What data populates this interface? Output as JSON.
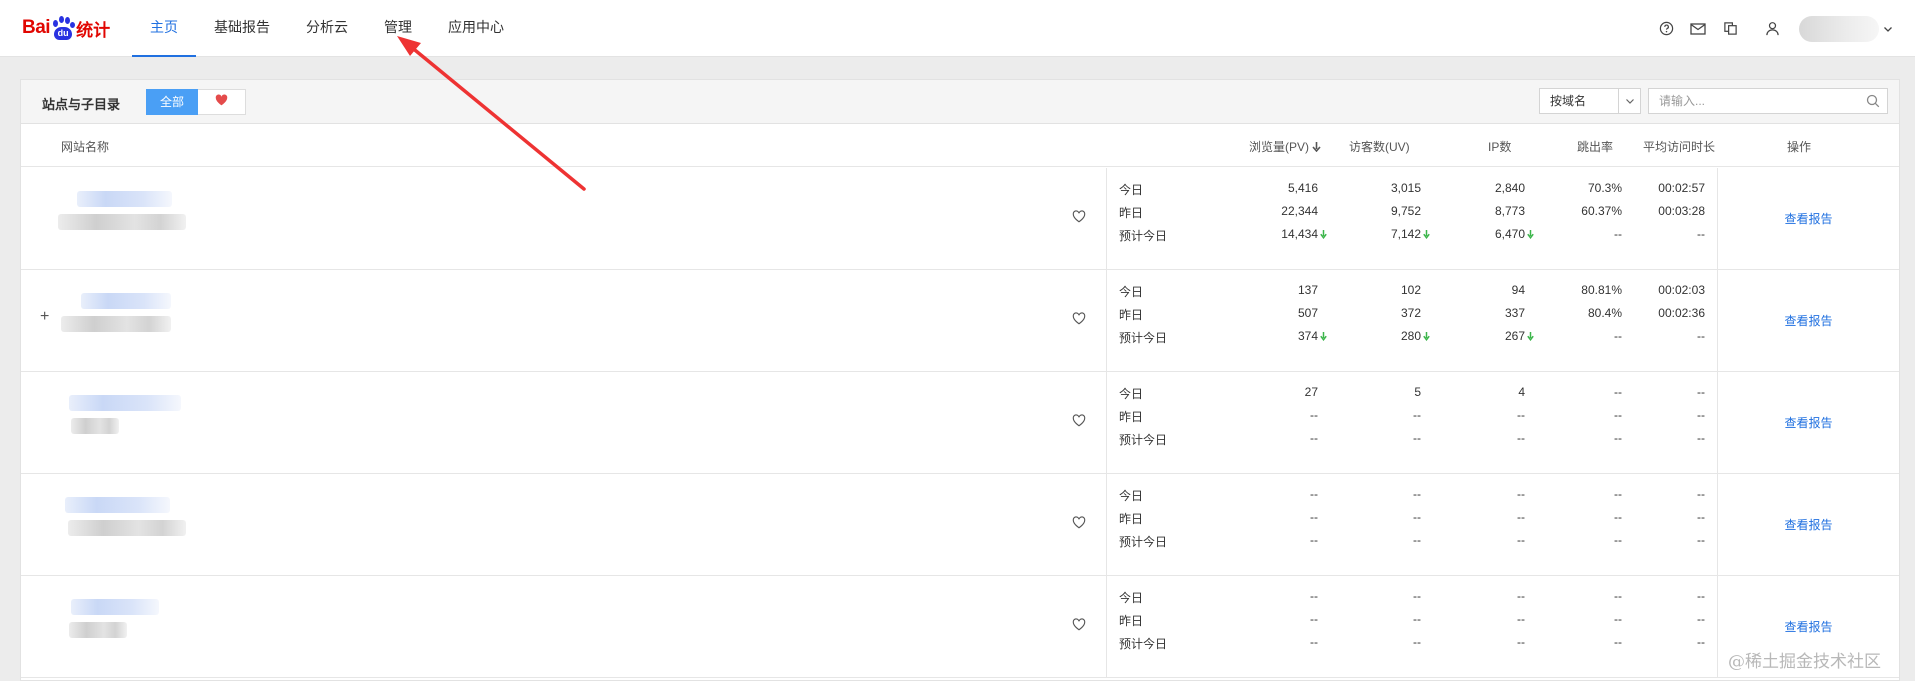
{
  "app": {
    "logo_text_bai": "Bai",
    "logo_text_du": "du",
    "logo_text_tongji": "统计"
  },
  "nav": {
    "items": [
      {
        "label": "主页",
        "active": true
      },
      {
        "label": "基础报告",
        "active": false
      },
      {
        "label": "分析云",
        "active": false
      },
      {
        "label": "管理",
        "active": false
      },
      {
        "label": "应用中心",
        "active": false
      }
    ]
  },
  "topbar_icons": [
    "help-icon",
    "mail-icon",
    "copy-icon",
    "user-icon",
    "chevron-down-icon"
  ],
  "panel": {
    "title": "站点与子目录",
    "filter_all": "全部",
    "filter_fav_icon": "heart-icon",
    "domain_select": "按域名",
    "search_placeholder": "请输入...",
    "colors": {
      "accent": "#4a9ff5",
      "link": "#2070e0",
      "heart": "#e44b4b",
      "down_arrow": "#3bb54a"
    }
  },
  "table": {
    "headers": {
      "site": "网站名称",
      "pv": "浏览量(PV)",
      "uv": "访客数(UV)",
      "ip": "IP数",
      "bounce": "跳出率",
      "avg_time": "平均访问时长",
      "action": "操作"
    },
    "sort_indicator": "pv-desc",
    "rows": [
      {
        "expandable": false,
        "action": "查看报告",
        "lines": [
          {
            "label": "今日",
            "pv": "5,416",
            "uv": "3,015",
            "ip": "2,840",
            "bounce": "70.3%",
            "avg": "00:02:57"
          },
          {
            "label": "昨日",
            "pv": "22,344",
            "uv": "9,752",
            "ip": "8,773",
            "bounce": "60.37%",
            "avg": "00:03:28"
          },
          {
            "label": "预计今日",
            "pv": "14,434",
            "uv": "7,142",
            "ip": "6,470",
            "bounce": "--",
            "avg": "--",
            "trend": "down"
          }
        ]
      },
      {
        "expandable": true,
        "expand_label": "+",
        "action": "查看报告",
        "lines": [
          {
            "label": "今日",
            "pv": "137",
            "uv": "102",
            "ip": "94",
            "bounce": "80.81%",
            "avg": "00:02:03"
          },
          {
            "label": "昨日",
            "pv": "507",
            "uv": "372",
            "ip": "337",
            "bounce": "80.4%",
            "avg": "00:02:36"
          },
          {
            "label": "预计今日",
            "pv": "374",
            "uv": "280",
            "ip": "267",
            "bounce": "--",
            "avg": "--",
            "trend": "down"
          }
        ]
      },
      {
        "expandable": false,
        "action": "查看报告",
        "lines": [
          {
            "label": "今日",
            "pv": "27",
            "uv": "5",
            "ip": "4",
            "bounce": "--",
            "avg": "--"
          },
          {
            "label": "昨日",
            "pv": "--",
            "uv": "--",
            "ip": "--",
            "bounce": "--",
            "avg": "--"
          },
          {
            "label": "预计今日",
            "pv": "--",
            "uv": "--",
            "ip": "--",
            "bounce": "--",
            "avg": "--"
          }
        ]
      },
      {
        "expandable": false,
        "action": "查看报告",
        "lines": [
          {
            "label": "今日",
            "pv": "--",
            "uv": "--",
            "ip": "--",
            "bounce": "--",
            "avg": "--"
          },
          {
            "label": "昨日",
            "pv": "--",
            "uv": "--",
            "ip": "--",
            "bounce": "--",
            "avg": "--"
          },
          {
            "label": "预计今日",
            "pv": "--",
            "uv": "--",
            "ip": "--",
            "bounce": "--",
            "avg": "--"
          }
        ]
      },
      {
        "expandable": false,
        "action": "查看报告",
        "lines": [
          {
            "label": "今日",
            "pv": "--",
            "uv": "--",
            "ip": "--",
            "bounce": "--",
            "avg": "--"
          },
          {
            "label": "昨日",
            "pv": "--",
            "uv": "--",
            "ip": "--",
            "bounce": "--",
            "avg": "--"
          },
          {
            "label": "预计今日",
            "pv": "--",
            "uv": "--",
            "ip": "--",
            "bounce": "--",
            "avg": "--"
          }
        ]
      }
    ]
  },
  "watermark": "@稀土掘金技术社区"
}
